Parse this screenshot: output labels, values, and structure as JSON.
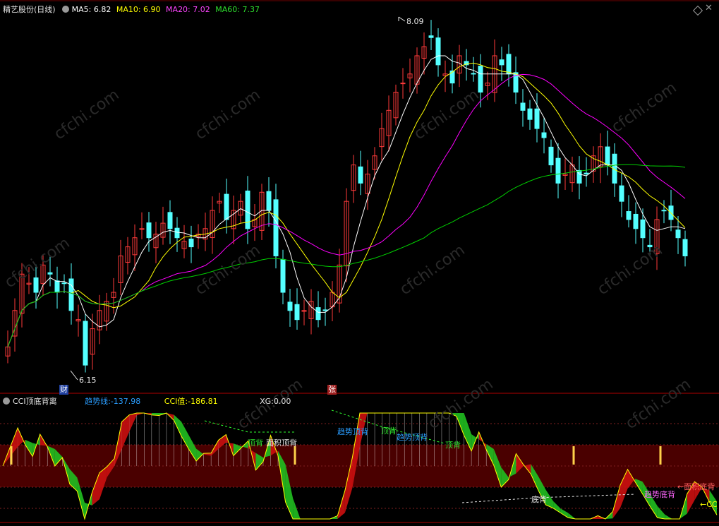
{
  "header": {
    "stock_name": "精艺股份",
    "period": "(日线)",
    "ma5_label": "MA5:",
    "ma5_value": "6.82",
    "ma10_label": "MA10:",
    "ma10_value": "6.90",
    "ma20_label": "MA20:",
    "ma20_value": "7.02",
    "ma60_label": "MA60:",
    "ma60_value": "7.37"
  },
  "indicator_header": {
    "name": "CCI顶底背离",
    "trend_label": "趋势线:",
    "trend_value": "-137.98",
    "cci_label": "CCI值:",
    "cci_value": "-186.81",
    "xg_label": "XG:",
    "xg_value": "0.00"
  },
  "markers": {
    "high_price": "8.09",
    "low_price": "6.15",
    "cai_badge": "财",
    "zhang_badge": "张"
  },
  "annotations": {
    "a1": "顶背",
    "a2": "面积顶背",
    "a3": "趋势顶背",
    "a4": "顶背",
    "a5": "趋势顶背",
    "a6": "顶背",
    "a7": "底背",
    "a8": "趋势底背",
    "a9": "←面积底背",
    "a10": "←CC"
  },
  "watermark": "cfchi.com",
  "colors": {
    "up": "#ff3a3a",
    "down": "#54ffff",
    "ma5": "#ffffff",
    "ma10": "#ffff00",
    "ma20": "#ff00ff",
    "ma60": "#00d000",
    "trend": "#2a9dff",
    "cci": "#ffff00",
    "xg": "#e0e0e0",
    "band": "#4a0000"
  },
  "chart_data": {
    "type": "candlestick",
    "price_range": [
      6.15,
      8.09
    ],
    "high": 8.09,
    "low": 6.15,
    "candles_close": [
      6.3,
      6.5,
      6.7,
      6.65,
      6.6,
      6.75,
      6.7,
      6.6,
      6.65,
      6.5,
      6.45,
      6.2,
      6.4,
      6.5,
      6.55,
      6.6,
      6.8,
      6.85,
      6.9,
      6.95,
      6.9,
      6.92,
      6.98,
      6.95,
      6.9,
      6.88,
      6.85,
      6.92,
      6.95,
      7.05,
      7.1,
      7.0,
      7.05,
      7.1,
      6.95,
      7.0,
      7.15,
      7.05,
      6.8,
      6.6,
      6.5,
      6.45,
      6.5,
      6.55,
      6.45,
      6.5,
      6.6,
      6.75,
      7.1,
      7.3,
      7.2,
      7.25,
      7.35,
      7.5,
      7.6,
      7.7,
      7.75,
      7.8,
      7.9,
      7.95,
      8.0,
      7.85,
      7.8,
      7.75,
      7.9,
      7.85,
      7.8,
      7.7,
      7.75,
      7.9,
      7.85,
      7.8,
      7.7,
      7.6,
      7.55,
      7.5,
      7.45,
      7.3,
      7.2,
      7.25,
      7.3,
      7.2,
      7.25,
      7.35,
      7.4,
      7.3,
      7.2,
      7.1,
      7.0,
      6.95,
      6.9,
      6.85,
      7.0,
      7.05,
      7.0,
      6.9,
      6.8
    ],
    "ma5_value": 6.82,
    "ma10_value": 6.9,
    "ma20_value": 7.02,
    "ma60_value": 7.37,
    "indicator": {
      "name": "CCI顶底背离",
      "trend_value": -137.98,
      "cci_value": -186.81,
      "xg_value": 0.0
    }
  }
}
